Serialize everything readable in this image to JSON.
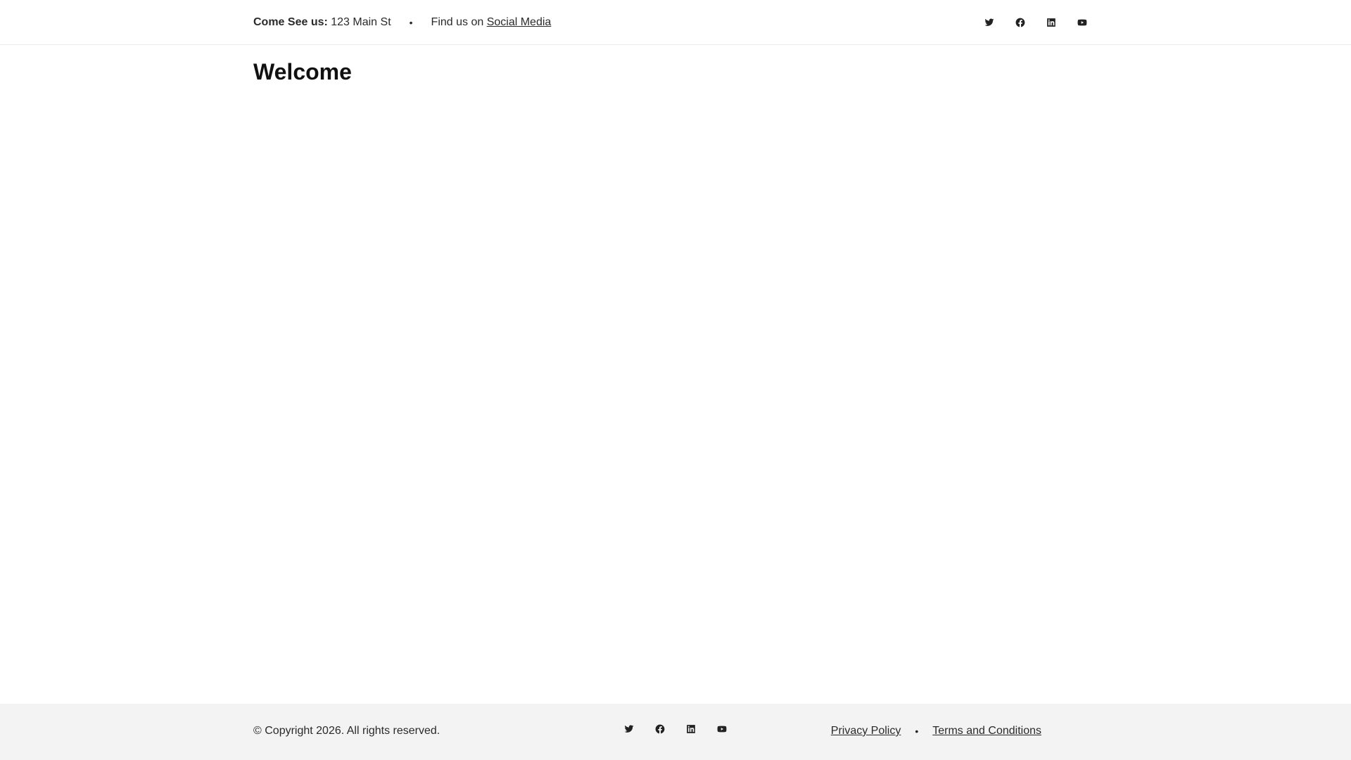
{
  "header": {
    "address_label": "Come See us:",
    "address_value": " 123 Main St",
    "separator": "•",
    "find_text": "Find us on ",
    "social_link": "Social Media",
    "social_icons": [
      "twitter-icon",
      "facebook-icon",
      "linkedin-icon",
      "youtube-icon"
    ]
  },
  "main": {
    "title": "Welcome"
  },
  "footer": {
    "copyright": "© Copyright 2026. All rights reserved.",
    "social_icons": [
      "twitter-icon",
      "facebook-icon",
      "linkedin-icon",
      "youtube-icon"
    ],
    "links": {
      "privacy": "Privacy Policy",
      "separator": "•",
      "terms": "Terms and Conditions"
    }
  },
  "colors": {
    "text": "#222222",
    "footer_bg": "#f3f3f3",
    "border": "#ebebeb"
  }
}
